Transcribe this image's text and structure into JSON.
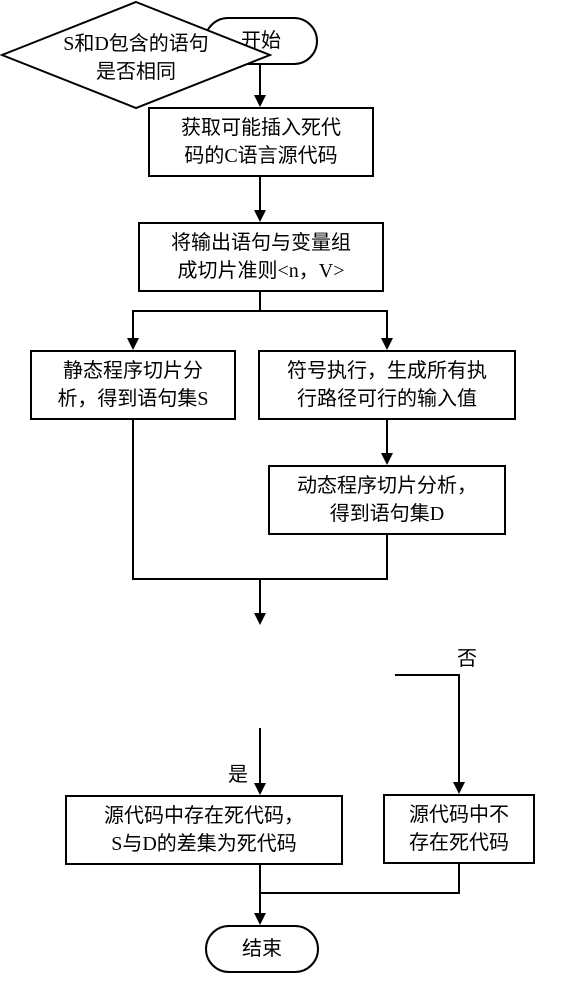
{
  "flow": {
    "start": "开始",
    "end": "结束",
    "step1": "获取可能插入死代\n码的C语言源代码",
    "step2": "将输出语句与变量组\n成切片准则<n，V>",
    "step3_left": "静态程序切片分\n析，得到语句集S",
    "step3_right": "符号执行，生成所有执\n行路径可行的输入值",
    "step4_right": "动态程序切片分析，\n得到语句集D",
    "decision": "S和D包含的语句\n是否相同",
    "result_yes": "源代码中存在死代码，\nS与D的差集为死代码",
    "result_no": "源代码中不\n存在死代码",
    "label_yes": "是",
    "label_no": "否"
  }
}
